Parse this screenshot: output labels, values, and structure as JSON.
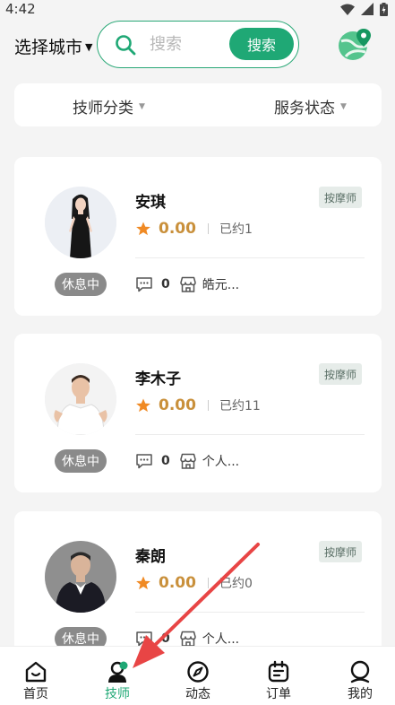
{
  "status_bar": {
    "time": "4:42"
  },
  "header": {
    "city_label": "选择城市",
    "search": {
      "placeholder": "搜索",
      "button_label": "搜索"
    }
  },
  "filters": {
    "category_label": "技师分类",
    "status_label": "服务状态"
  },
  "technicians": [
    {
      "name": "安琪",
      "tag": "按摩师",
      "rating": "0.00",
      "booked": "已约1",
      "status": "休息中",
      "comment_count": "0",
      "shop": "皓元..."
    },
    {
      "name": "李木子",
      "tag": "按摩师",
      "rating": "0.00",
      "booked": "已约11",
      "status": "休息中",
      "comment_count": "0",
      "shop": "个人..."
    },
    {
      "name": "秦朗",
      "tag": "按摩师",
      "rating": "0.00",
      "booked": "已约0",
      "status": "休息中",
      "comment_count": "0",
      "shop": "个人..."
    }
  ],
  "tabbar": {
    "items": [
      {
        "label": "首页",
        "icon": "home-icon"
      },
      {
        "label": "技师",
        "icon": "technician-icon",
        "active": true
      },
      {
        "label": "动态",
        "icon": "compass-icon"
      },
      {
        "label": "订单",
        "icon": "orders-icon"
      },
      {
        "label": "我的",
        "icon": "profile-icon"
      }
    ]
  },
  "colors": {
    "accent": "#1fa875",
    "rating": "#c9903b",
    "star": "#f08a24",
    "status_pill": "#8a8a8a",
    "annotation_arrow": "#e84545"
  }
}
